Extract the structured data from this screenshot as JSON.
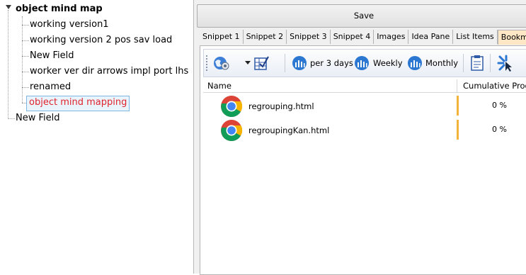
{
  "tree": {
    "root_label": "object mind map",
    "children": [
      "working version1",
      "working version 2 pos sav load",
      "New Field",
      "worker ver dir arrows impl port lhs",
      "renamed",
      "object mind mapping"
    ],
    "sibling_label": "New Field",
    "selected_index": 5
  },
  "toolbar": {
    "save_label": "Save",
    "per3days_label": "per 3 days",
    "weekly_label": "Weekly",
    "monthly_label": "Monthly"
  },
  "tabs": [
    "Snippet 1",
    "Snippet 2",
    "Snippet 3",
    "Snippet 4",
    "Images",
    "Idea Pane",
    "List Items",
    "Bookmarks"
  ],
  "active_tab": "Bookmarks",
  "grid": {
    "columns": {
      "name": "Name",
      "progress": "Cumulative Progress"
    },
    "rows": [
      {
        "file": "regrouping.html",
        "progress": "0 %"
      },
      {
        "file": "regroupingKan.html",
        "progress": "0 %"
      }
    ]
  },
  "colors": {
    "selected_text": "#e0242e",
    "progress_accent": "#f4b43a",
    "active_tab_bg": "#fde7c4"
  }
}
